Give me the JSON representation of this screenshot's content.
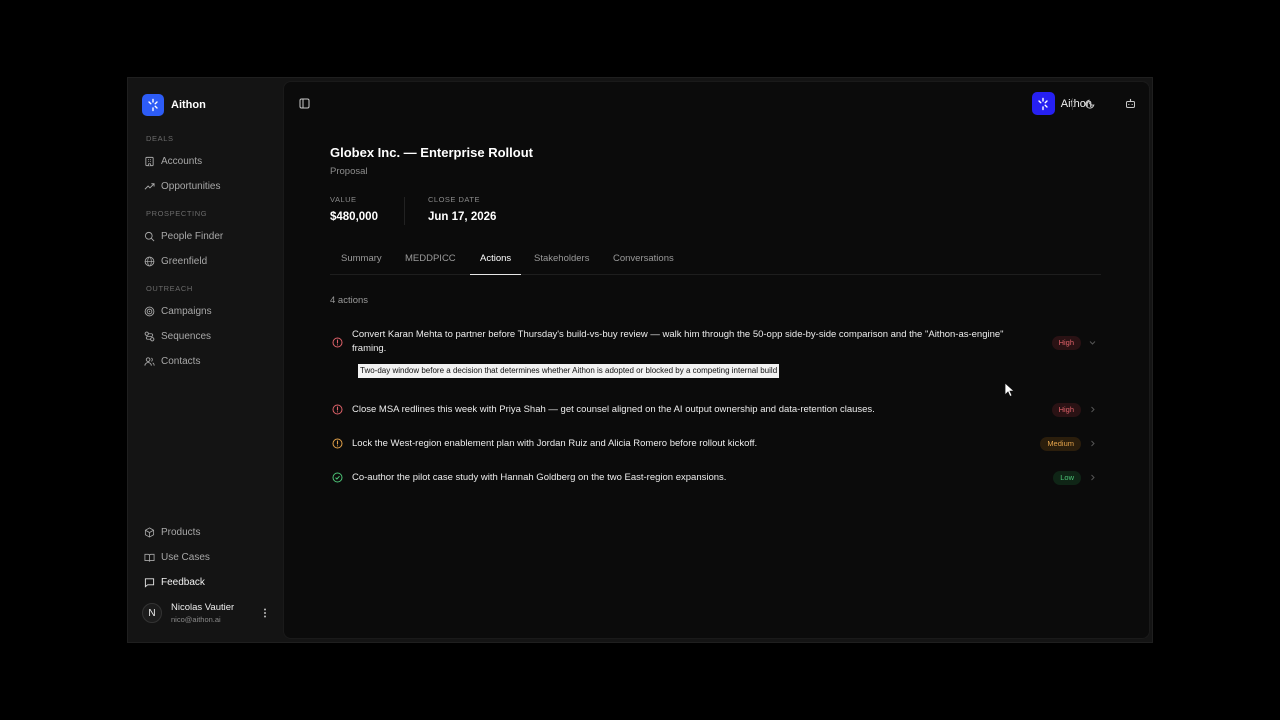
{
  "brand": {
    "name": "Aithon"
  },
  "sidebar": {
    "sections": [
      {
        "heading": "DEALS",
        "items": [
          {
            "label": "Accounts",
            "icon": "building-icon"
          },
          {
            "label": "Opportunities",
            "icon": "trending-up-icon"
          }
        ]
      },
      {
        "heading": "PROSPECTING",
        "items": [
          {
            "label": "People Finder",
            "icon": "search-icon"
          },
          {
            "label": "Greenfield",
            "icon": "globe-icon"
          }
        ]
      },
      {
        "heading": "OUTREACH",
        "items": [
          {
            "label": "Campaigns",
            "icon": "target-icon"
          },
          {
            "label": "Sequences",
            "icon": "sequence-icon"
          },
          {
            "label": "Contacts",
            "icon": "users-icon"
          }
        ]
      }
    ],
    "bottom_items": [
      {
        "label": "Products",
        "icon": "box-icon"
      },
      {
        "label": "Use Cases",
        "icon": "book-icon"
      },
      {
        "label": "Feedback",
        "icon": "message-icon"
      }
    ],
    "user": {
      "initial": "N",
      "name": "Nicolas Vautier",
      "email": "nico@aithon.ai"
    }
  },
  "topbar": {
    "brand_name": "Aithon"
  },
  "deal": {
    "title": "Globex Inc. — Enterprise Rollout",
    "stage": "Proposal",
    "value_label": "VALUE",
    "value": "$480,000",
    "close_label": "CLOSE DATE",
    "close_date": "Jun 17, 2026"
  },
  "tabs": [
    "Summary",
    "MEDDPICC",
    "Actions",
    "Stakeholders",
    "Conversations"
  ],
  "active_tab": "Actions",
  "actions": {
    "count_label": "4 actions",
    "items": [
      {
        "text": "Convert Karan Mehta to partner before Thursday's build-vs-buy review — walk him through the 50-opp side-by-side comparison and the \"Aithon-as-engine\" framing.",
        "priority": "High",
        "status": "open"
      },
      {
        "text": "Close MSA redlines this week with Priya Shah — get counsel aligned on the AI output ownership and data-retention clauses.",
        "priority": "High",
        "status": "open"
      },
      {
        "text": "Lock the West-region enablement plan with Jordan Ruiz and Alicia Romero before rollout kickoff.",
        "priority": "Medium",
        "status": "open"
      },
      {
        "text": "Co-author the pilot case study with Hannah Goldberg on the two East-region expansions.",
        "priority": "Low",
        "status": "done"
      }
    ],
    "tooltip": "Two-day window before a decision that determines whether Aithon is adopted or blocked by a competing internal build"
  },
  "colors": {
    "accent": "#2d5cf6",
    "high": "#e0626a",
    "medium": "#e3a24a",
    "low": "#4dc577"
  }
}
